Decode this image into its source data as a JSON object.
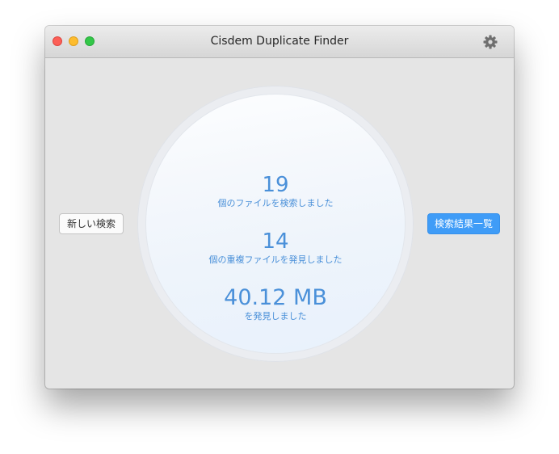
{
  "window": {
    "title": "Cisdem Duplicate Finder",
    "controls": [
      "close",
      "minimize",
      "maximize"
    ],
    "settings_icon": "gear-icon"
  },
  "buttons": {
    "new_search": "新しい検索",
    "view_results": "検索結果一覧"
  },
  "stats": {
    "files_scanned": {
      "value": "19",
      "label": "個のファイルを検索しました"
    },
    "duplicates_found": {
      "value": "14",
      "label": "個の重複ファイルを発見しました"
    },
    "size_found": {
      "value": "40.12 MB",
      "label": "を発見しました"
    }
  },
  "colors": {
    "accent": "#4a90d9",
    "button_primary": "#3f9cf7",
    "window_bg": "#e5e5e5"
  }
}
